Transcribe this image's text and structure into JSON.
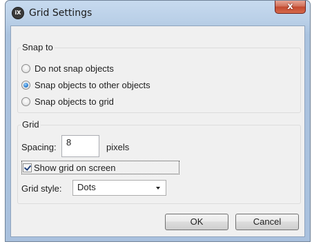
{
  "window": {
    "title": "Grid Settings",
    "close_label": "x",
    "app_icon_label": "iX"
  },
  "snap_group": {
    "legend": "Snap to",
    "options": [
      {
        "label": "Do not snap objects",
        "selected": false
      },
      {
        "label": "Snap objects to other objects",
        "selected": true
      },
      {
        "label": "Snap objects to grid",
        "selected": false
      }
    ]
  },
  "grid_group": {
    "legend": "Grid",
    "spacing_label": "Spacing:",
    "spacing_value": "8",
    "spacing_unit": "pixels",
    "show_grid_label": "Show grid on screen",
    "show_grid_checked": true,
    "style_label": "Grid style:",
    "style_value": "Dots"
  },
  "buttons": {
    "ok": "OK",
    "cancel": "Cancel"
  }
}
